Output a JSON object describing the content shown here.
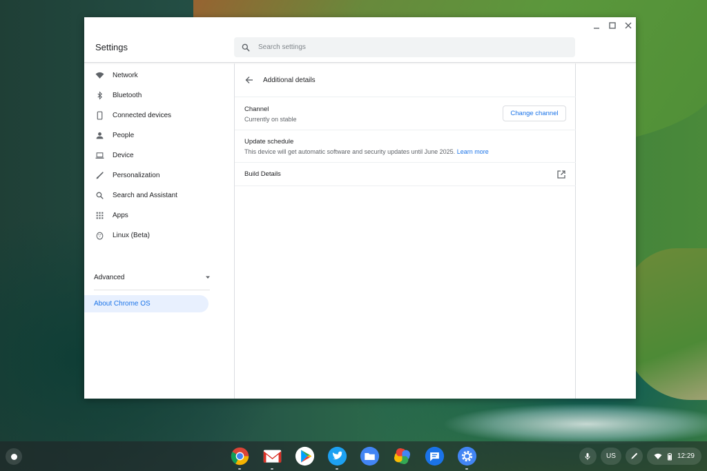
{
  "window": {
    "title": "Settings"
  },
  "search": {
    "placeholder": "Search settings"
  },
  "sidebar": {
    "items": [
      {
        "label": "Network",
        "icon": "wifi-icon"
      },
      {
        "label": "Bluetooth",
        "icon": "bluetooth-icon"
      },
      {
        "label": "Connected devices",
        "icon": "phone-icon"
      },
      {
        "label": "People",
        "icon": "person-icon"
      },
      {
        "label": "Device",
        "icon": "laptop-icon"
      },
      {
        "label": "Personalization",
        "icon": "brush-icon"
      },
      {
        "label": "Search and Assistant",
        "icon": "search-icon"
      },
      {
        "label": "Apps",
        "icon": "apps-grid-icon"
      },
      {
        "label": "Linux (Beta)",
        "icon": "linux-penguin-icon"
      }
    ],
    "advanced_label": "Advanced",
    "about_label": "About Chrome OS"
  },
  "page": {
    "title": "Additional details",
    "channel": {
      "title": "Channel",
      "subtitle": "Currently on stable",
      "button_label": "Change channel"
    },
    "update_schedule": {
      "title": "Update schedule",
      "subtitle": "This device will get automatic software and security updates until June 2025.",
      "link_label": "Learn more"
    },
    "build_details": {
      "title": "Build Details"
    }
  },
  "shelf": {
    "apps": [
      "chrome-icon",
      "gmail-icon",
      "play-store-icon",
      "twitter-icon",
      "files-icon",
      "photos-icon",
      "messages-icon",
      "settings-icon"
    ],
    "keyboard_layout": "US",
    "time": "12:29"
  },
  "colors": {
    "accent": "#1a73e8",
    "selected_bg": "#e8f0fe"
  }
}
